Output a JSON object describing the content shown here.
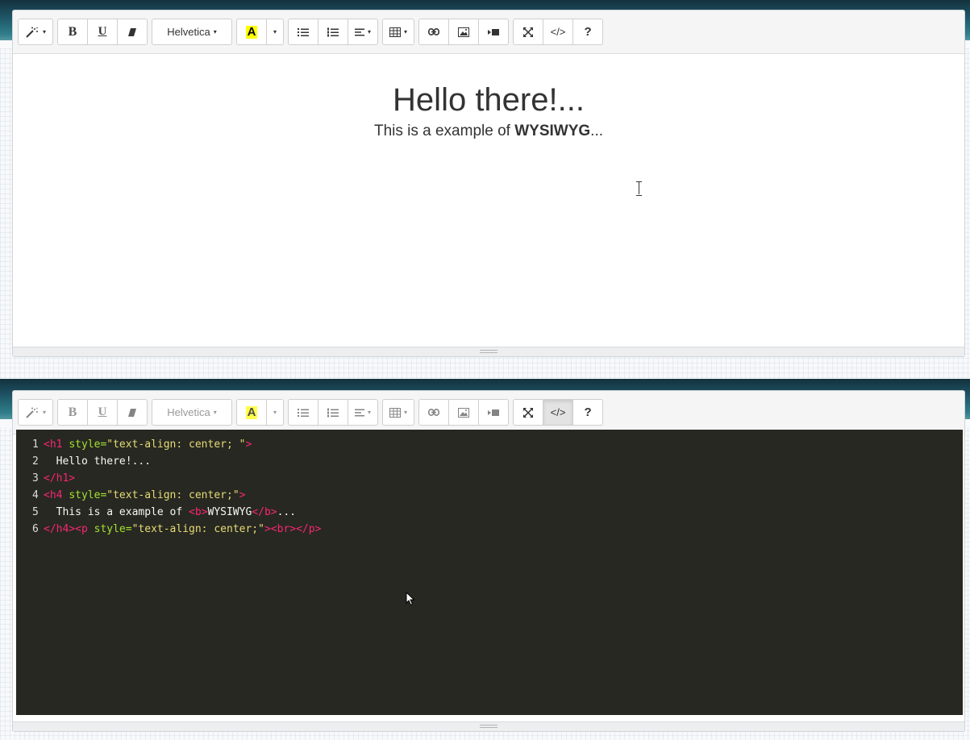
{
  "toolbar": {
    "style_caret": "▾",
    "bold": "B",
    "underline": "U",
    "font_name": "Helvetica",
    "font_caret": "▾",
    "highlight_letter": "A",
    "color_caret": "▾",
    "align_caret": "▾",
    "table_caret": "▾",
    "codeview": "</>",
    "help": "?",
    "highlight_color": "#ffff00",
    "icons": [
      "magic-icon",
      "eraser-icon",
      "unordered-list-icon",
      "ordered-list-icon",
      "align-icon",
      "table-icon",
      "link-icon",
      "picture-icon",
      "video-icon",
      "fullscreen-icon"
    ]
  },
  "wysiwyg": {
    "heading": "Hello there!...",
    "sub_prefix": "This is a example of ",
    "sub_bold": "WYSIWYG",
    "sub_suffix": "..."
  },
  "code": {
    "lines": [
      {
        "num": "1",
        "tokens": [
          [
            "tag",
            "<h1 "
          ],
          [
            "attr",
            "style="
          ],
          [
            "str",
            "\"text-align: center; \""
          ],
          [
            "tag",
            ">"
          ]
        ]
      },
      {
        "num": "2",
        "tokens": [
          [
            "txt",
            "  Hello there!..."
          ]
        ]
      },
      {
        "num": "3",
        "tokens": [
          [
            "tag",
            "</h1>"
          ]
        ]
      },
      {
        "num": "4",
        "tokens": [
          [
            "tag",
            "<h4 "
          ],
          [
            "attr",
            "style="
          ],
          [
            "str",
            "\"text-align: center;\""
          ],
          [
            "tag",
            ">"
          ]
        ]
      },
      {
        "num": "5",
        "tokens": [
          [
            "txt",
            "  This is a example of "
          ],
          [
            "tag",
            "<b>"
          ],
          [
            "txt",
            "WYSIWYG"
          ],
          [
            "tag",
            "</b>"
          ],
          [
            "txt",
            "..."
          ]
        ]
      },
      {
        "num": "6",
        "tokens": [
          [
            "tag",
            "</h4><p "
          ],
          [
            "attr",
            "style="
          ],
          [
            "str",
            "\"text-align: center;\""
          ],
          [
            "tag",
            "><br></p>"
          ]
        ]
      }
    ]
  }
}
